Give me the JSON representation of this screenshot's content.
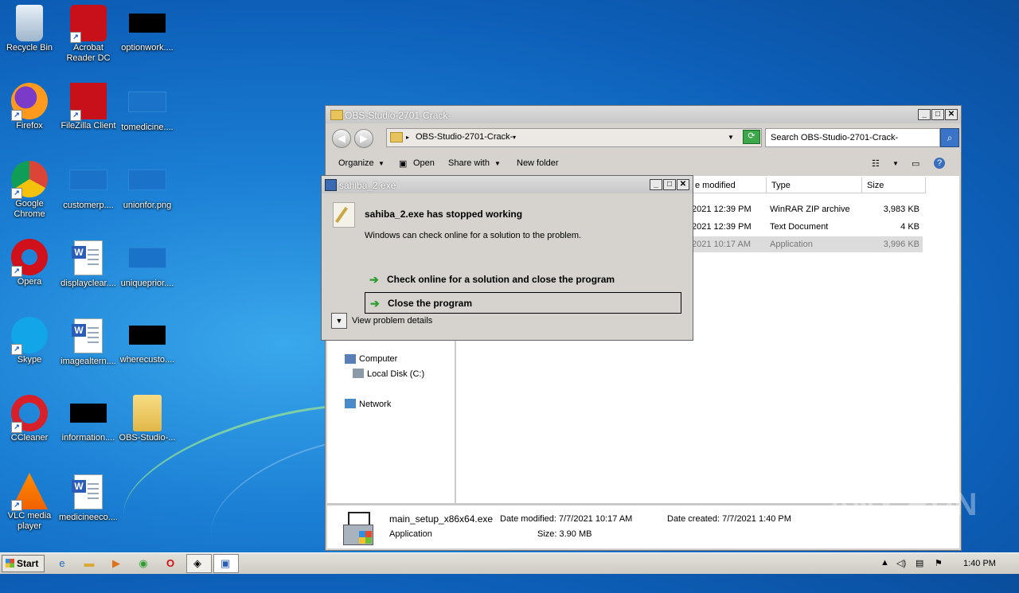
{
  "desktop": {
    "icons": [
      {
        "label": "Recycle Bin",
        "icon": "recycle-bin-icon"
      },
      {
        "label": "Acrobat Reader DC",
        "icon": "acrobat-icon"
      },
      {
        "label": "optionwork....",
        "icon": "black-thumbnail-icon"
      },
      {
        "label": "Firefox",
        "icon": "firefox-icon"
      },
      {
        "label": "FileZilla Client",
        "icon": "filezilla-icon"
      },
      {
        "label": "tomedicine....",
        "icon": "blue-thumbnail-icon"
      },
      {
        "label": "Google Chrome",
        "icon": "chrome-icon"
      },
      {
        "label": "customerp....",
        "icon": "blue-thumbnail-icon"
      },
      {
        "label": "unionfor.png",
        "icon": "blue-thumbnail-icon"
      },
      {
        "label": "Opera",
        "icon": "opera-icon"
      },
      {
        "label": "displayclear....",
        "icon": "word-doc-icon"
      },
      {
        "label": "uniqueprior....",
        "icon": "blue-thumbnail-icon"
      },
      {
        "label": "Skype",
        "icon": "skype-icon"
      },
      {
        "label": "imagealtern....",
        "icon": "word-doc-icon"
      },
      {
        "label": "wherecusto....",
        "icon": "black-thumbnail-icon"
      },
      {
        "label": "CCleaner",
        "icon": "ccleaner-icon"
      },
      {
        "label": "information....",
        "icon": "black-thumbnail-icon"
      },
      {
        "label": "OBS-Studio-...",
        "icon": "folder-icon"
      },
      {
        "label": "VLC media player",
        "icon": "vlc-icon"
      },
      {
        "label": "medicineeco....",
        "icon": "word-doc-icon"
      }
    ]
  },
  "explorer": {
    "title": "OBS-Studio-2701-Crack-",
    "address": "OBS-Studio-2701-Crack-",
    "search_placeholder": "Search OBS-Studio-2701-Crack-",
    "toolbar": {
      "organize": "Organize",
      "open": "Open",
      "share_with": "Share with",
      "new_folder": "New folder"
    },
    "columns": {
      "modified": "e modified",
      "type": "Type",
      "size": "Size"
    },
    "files": [
      {
        "modified": "2021 12:39 PM",
        "type": "WinRAR ZIP archive",
        "size": "3,983 KB"
      },
      {
        "modified": "2021 12:39 PM",
        "type": "Text Document",
        "size": "4 KB"
      },
      {
        "modified": "2021 10:17 AM",
        "type": "Application",
        "size": "3,996 KB"
      }
    ],
    "nav": {
      "computer": "Computer",
      "local_disk": "Local Disk (C:)",
      "network": "Network"
    },
    "details": {
      "filename": "main_setup_x86x64.exe",
      "filetype": "Application",
      "date_modified": "Date modified: 7/7/2021 10:17 AM",
      "date_created": "Date created: 7/7/2021 1:40 PM",
      "size": "Size: 3.90 MB"
    }
  },
  "dialog": {
    "title": "sahiba_2.exe",
    "heading": "sahiba_2.exe has stopped working",
    "message": "Windows can check online for a solution to the problem.",
    "option_check": "Check online for a solution and close the program",
    "option_close": "Close the program",
    "view_details": "View problem details"
  },
  "taskbar": {
    "start": "Start",
    "clock": "1:40 PM"
  },
  "watermark": "ANY RUN"
}
